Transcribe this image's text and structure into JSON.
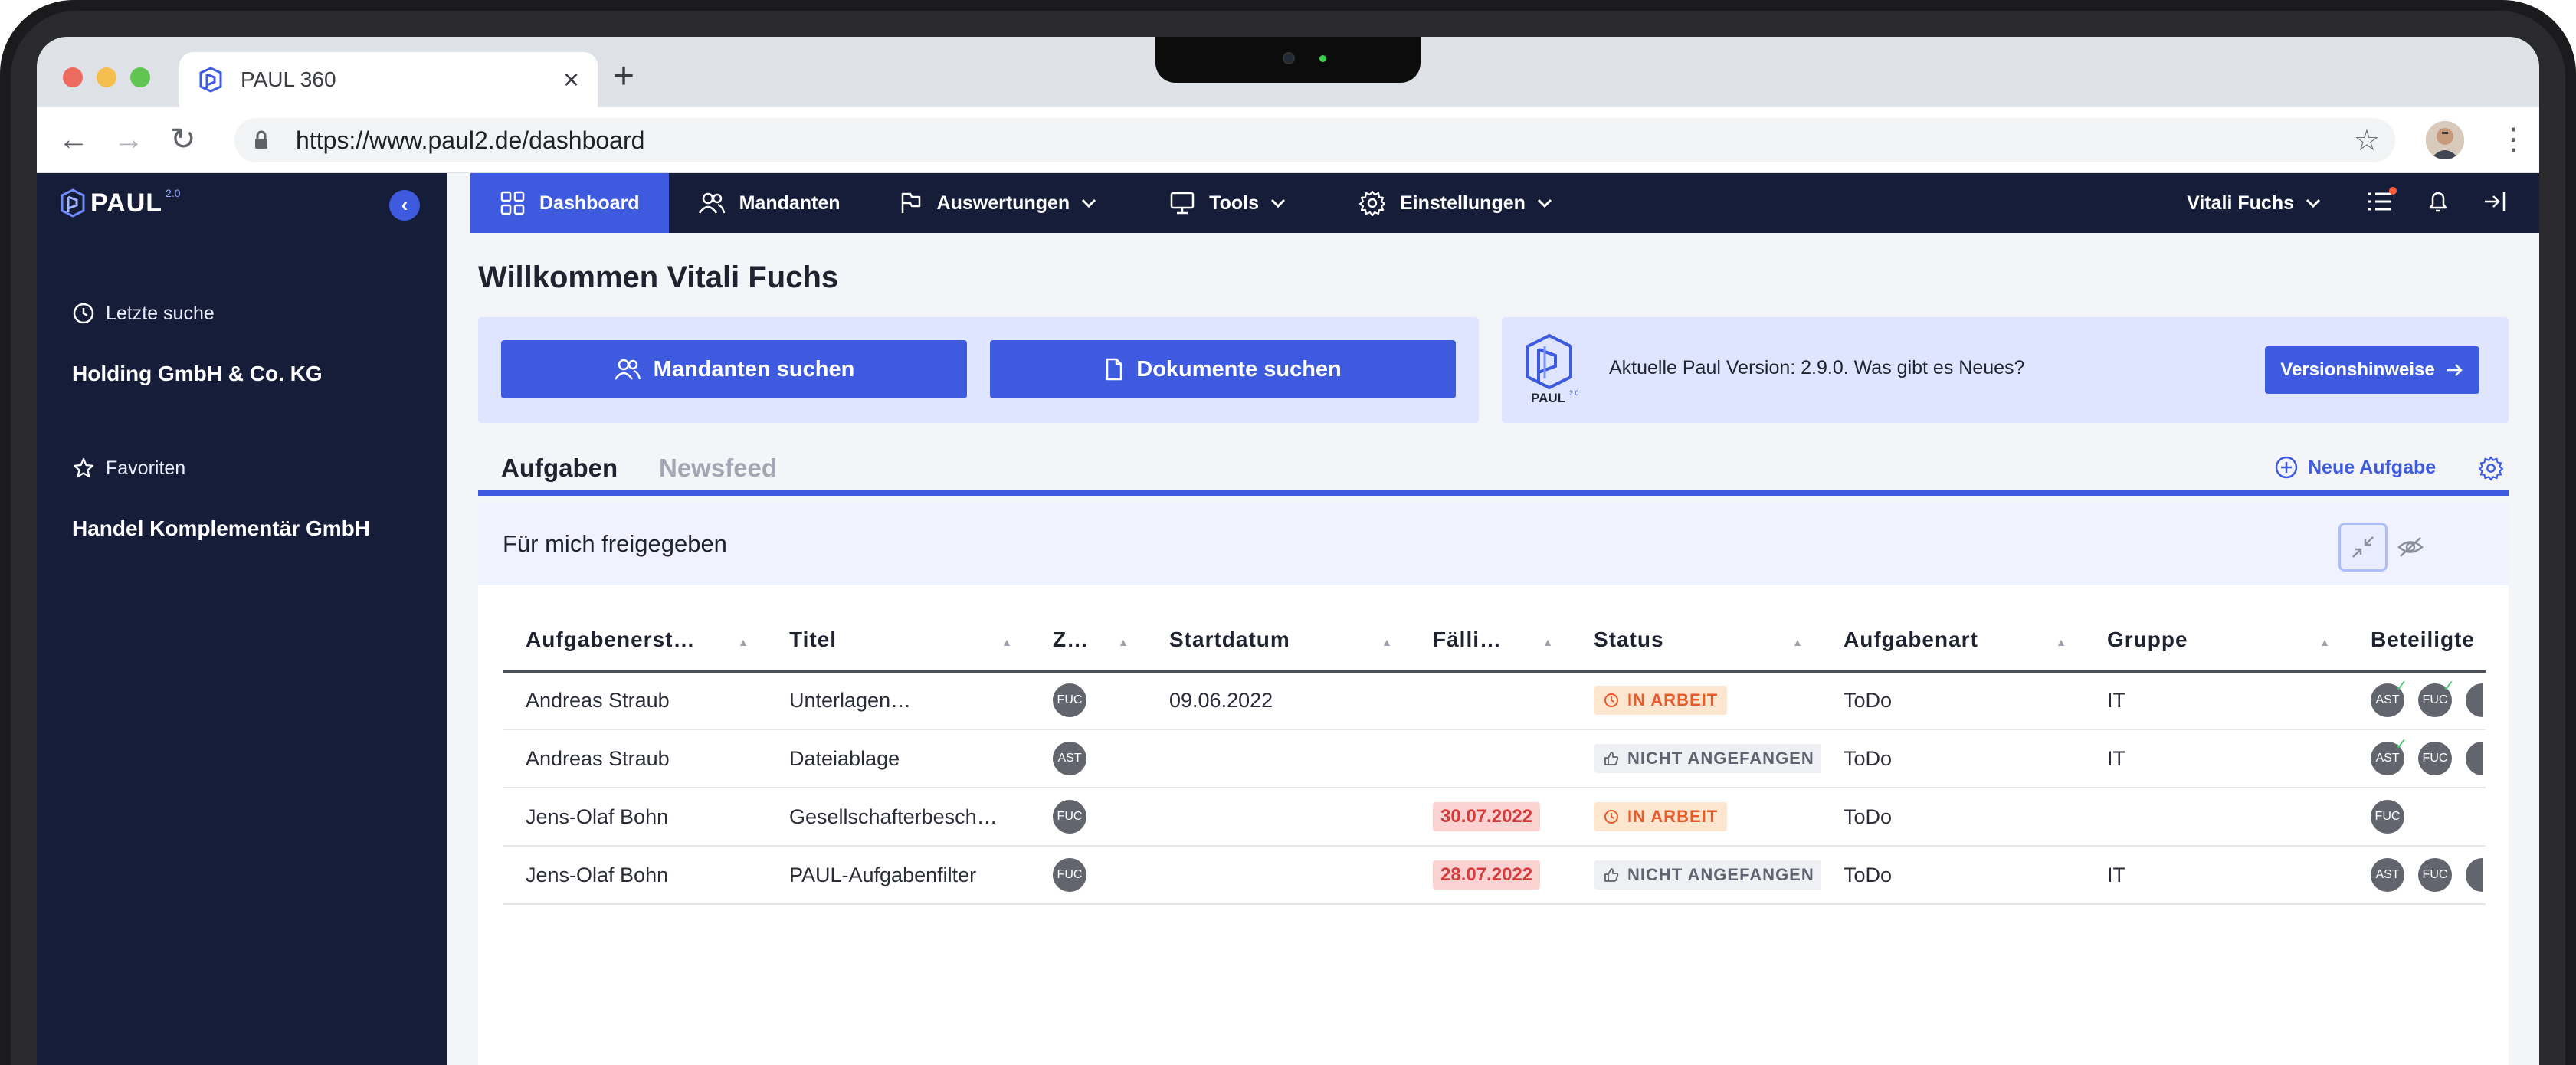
{
  "browser": {
    "tab_title": "PAUL 360",
    "tab_close": "×",
    "new_tab": "+",
    "url": "https://www.paul2.de/dashboard",
    "back": "←",
    "forward": "→",
    "reload": "↻",
    "bookmark": "☆",
    "menu": "⋮"
  },
  "sidebar": {
    "logo_text": "PAUL",
    "logo_sup": "2.0",
    "collapse": "‹",
    "recent_label": "Letzte suche",
    "recent_item": "Holding GmbH & Co. KG",
    "fav_label": "Favoriten",
    "fav_item": "Handel Komplementär GmbH"
  },
  "topnav": {
    "items": [
      {
        "label": "Dashboard"
      },
      {
        "label": "Mandanten"
      },
      {
        "label": "Auswertungen"
      },
      {
        "label": "Tools"
      },
      {
        "label": "Einstellungen"
      }
    ],
    "user": "Vitali Fuchs"
  },
  "main": {
    "welcome": "Willkommen Vitali Fuchs",
    "search_clients": "Mandanten suchen",
    "search_docs": "Dokumente suchen",
    "version_logo": "PAUL",
    "version_logo_sup": "2.0",
    "version_text": "Aktuelle Paul Version: 2.9.0. Was gibt es Neues?",
    "version_button": "Versionshinweise",
    "tab_tasks": "Aufgaben",
    "tab_news": "Newsfeed",
    "new_task": "Neue Aufgabe",
    "card_title": "Für mich freigegeben"
  },
  "table": {
    "headers": [
      "Aufgabenerst…",
      "Titel",
      "Z…",
      "Startdatum",
      "Fälli…",
      "Status",
      "Aufgabenart",
      "Gruppe",
      "Beteiligte"
    ],
    "sort_glyph": "▲",
    "rows": [
      {
        "creator": "Andreas Straub",
        "title": "Unterlagen…",
        "assignee": "FUC",
        "start": "09.06.2022",
        "due": "",
        "status": "IN ARBEIT",
        "type": "ToDo",
        "group": "IT",
        "participants": [
          "AST",
          "FUC"
        ]
      },
      {
        "creator": "Andreas Straub",
        "title": "Dateiablage",
        "assignee": "AST",
        "start": "",
        "due": "",
        "status": "NICHT ANGEFANGEN",
        "type": "ToDo",
        "group": "IT",
        "participants": [
          "AST",
          "FUC"
        ]
      },
      {
        "creator": "Jens-Olaf Bohn",
        "title": "Gesellschafterbesch…",
        "assignee": "FUC",
        "start": "",
        "due": "30.07.2022",
        "status": "IN ARBEIT",
        "type": "ToDo",
        "group": "",
        "participants": [
          "FUC"
        ]
      },
      {
        "creator": "Jens-Olaf Bohn",
        "title": "PAUL-Aufgabenfilter",
        "assignee": "FUC",
        "start": "",
        "due": "28.07.2022",
        "status": "NICHT ANGEFANGEN",
        "type": "ToDo",
        "group": "IT",
        "participants": [
          "AST",
          "FUC"
        ]
      }
    ]
  },
  "colors": {
    "primary": "#3e5be0",
    "sidebar_bg": "#151d38",
    "panel_bg": "#dfe5ff",
    "status_work": "#e85b2b",
    "due_overdue": "#d63b3b"
  },
  "icons": {
    "check": "✓"
  }
}
